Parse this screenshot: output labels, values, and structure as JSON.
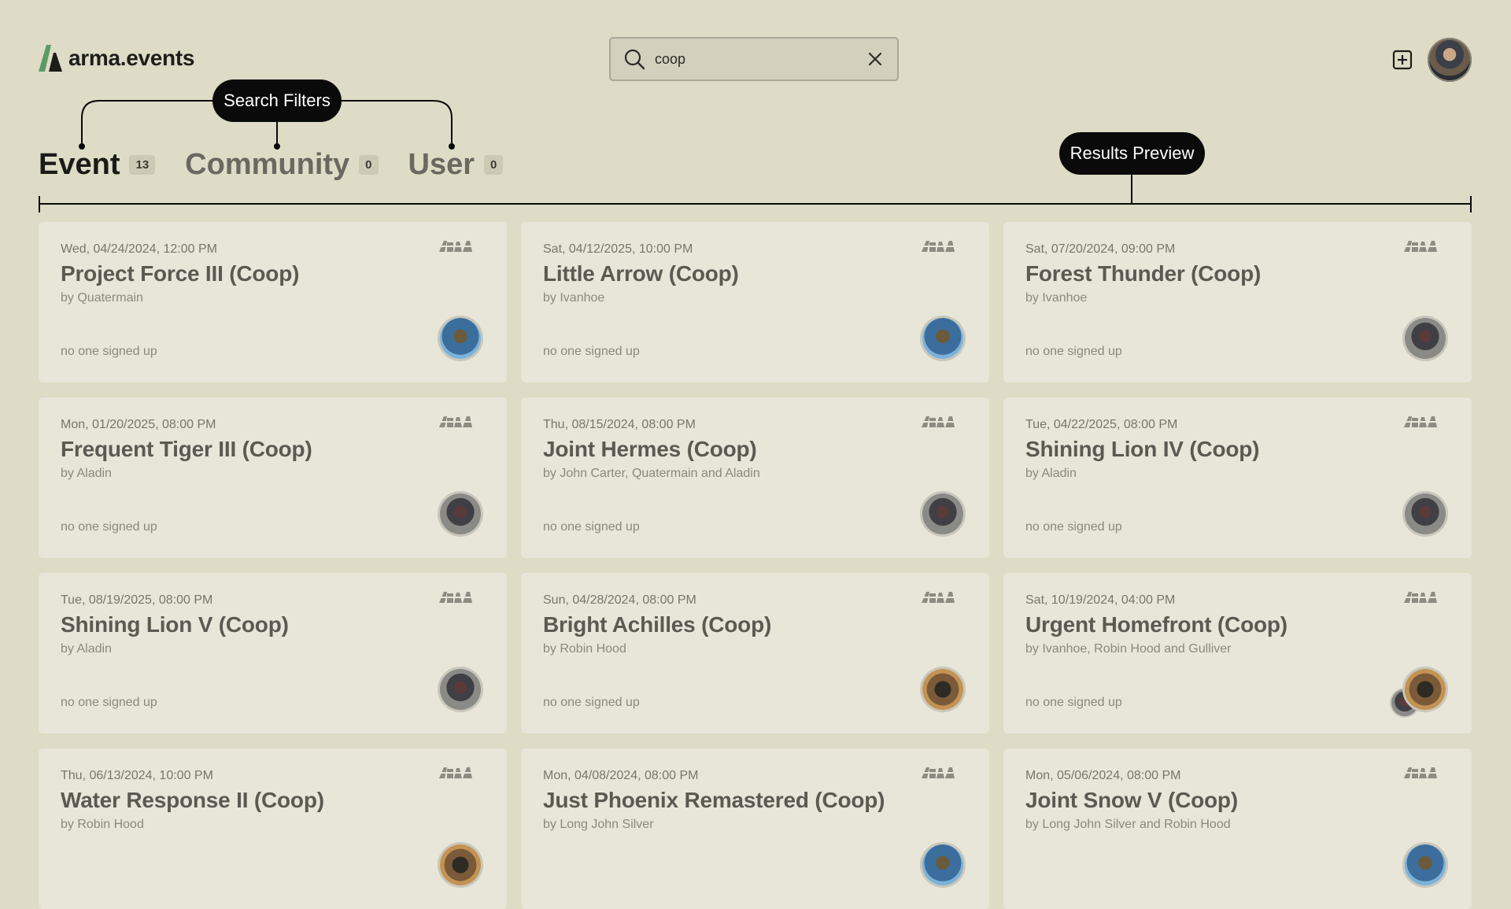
{
  "app": {
    "name": "arma.events"
  },
  "search": {
    "value": "coop",
    "placeholder": ""
  },
  "annotations": {
    "search_filters": "Search Filters",
    "results_preview": "Results Preview"
  },
  "tabs": [
    {
      "label": "Event",
      "count": "13",
      "active": true
    },
    {
      "label": "Community",
      "count": "0",
      "active": false
    },
    {
      "label": "User",
      "count": "0",
      "active": false
    }
  ],
  "results": [
    {
      "date": "Wed, 04/24/2024, 12:00 PM",
      "title": "Project Force III (Coop)",
      "by": "by Quatermain",
      "signup": "no one signed up",
      "avatar": "blue"
    },
    {
      "date": "Sat, 04/12/2025, 10:00 PM",
      "title": "Little Arrow (Coop)",
      "by": "by Ivanhoe",
      "signup": "no one signed up",
      "avatar": "blue"
    },
    {
      "date": "Sat, 07/20/2024, 09:00 PM",
      "title": "Forest Thunder (Coop)",
      "by": "by Ivanhoe",
      "signup": "no one signed up",
      "avatar": "grey"
    },
    {
      "date": "Mon, 01/20/2025, 08:00 PM",
      "title": "Frequent Tiger III (Coop)",
      "by": "by Aladin",
      "signup": "no one signed up",
      "avatar": "grey"
    },
    {
      "date": "Thu, 08/15/2024, 08:00 PM",
      "title": "Joint Hermes (Coop)",
      "by": "by John Carter, Quatermain and Aladin",
      "signup": "no one signed up",
      "avatar": "grey"
    },
    {
      "date": "Tue, 04/22/2025, 08:00 PM",
      "title": "Shining Lion IV (Coop)",
      "by": "by Aladin",
      "signup": "no one signed up",
      "avatar": "grey"
    },
    {
      "date": "Tue, 08/19/2025, 08:00 PM",
      "title": "Shining Lion V (Coop)",
      "by": "by Aladin",
      "signup": "no one signed up",
      "avatar": "grey"
    },
    {
      "date": "Sun, 04/28/2024, 08:00 PM",
      "title": "Bright Achilles (Coop)",
      "by": "by Robin Hood",
      "signup": "no one signed up",
      "avatar": "brown"
    },
    {
      "date": "Sat, 10/19/2024, 04:00 PM",
      "title": "Urgent Homefront (Coop)",
      "by": "by Ivanhoe, Robin Hood and Gulliver",
      "signup": "no one signed up",
      "avatar": "brown-stack"
    },
    {
      "date": "Thu, 06/13/2024, 10:00 PM",
      "title": "Water Response II (Coop)",
      "by": "by Robin Hood",
      "signup": "",
      "avatar": "brown"
    },
    {
      "date": "Mon, 04/08/2024, 08:00 PM",
      "title": "Just Phoenix Remastered (Coop)",
      "by": "by Long John Silver",
      "signup": "",
      "avatar": "blue"
    },
    {
      "date": "Mon, 05/06/2024, 08:00 PM",
      "title": "Joint Snow V (Coop)",
      "by": "by Long John Silver and Robin Hood",
      "signup": "",
      "avatar": "blue"
    }
  ],
  "icons": {
    "logo": "arma-logo-icon",
    "search": "search-icon",
    "clear": "close-icon",
    "add": "plus-square-icon",
    "game": "arma-game-icon"
  },
  "colors": {
    "background": "#dedbc6",
    "card": "#e8e6d9",
    "logo_green": "#5a9a64",
    "annotation": "#0a0a0a"
  }
}
